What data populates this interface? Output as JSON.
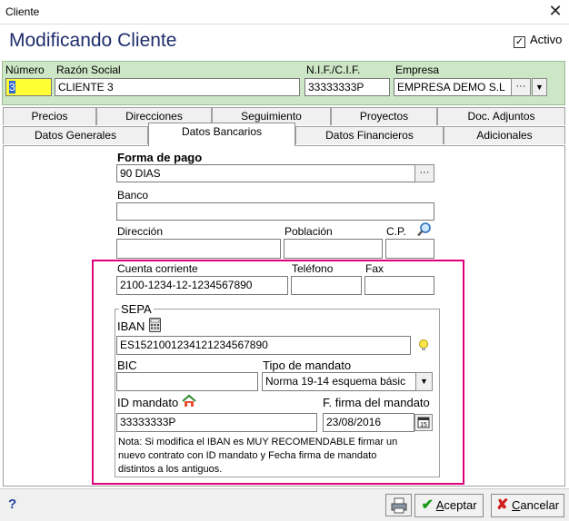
{
  "window": {
    "title": "Cliente",
    "close_glyph": "✕"
  },
  "heading": "Modificando Cliente",
  "activo": {
    "label": "Activo",
    "checked": true
  },
  "header_fields": {
    "numero": {
      "label": "Número",
      "value": "3"
    },
    "razon_social": {
      "label": "Razón Social",
      "value": "CLIENTE 3"
    },
    "nif": {
      "label": "N.I.F./C.I.F.",
      "value": "33333333P"
    },
    "empresa": {
      "label": "Empresa",
      "value": "EMPRESA DEMO S.L"
    }
  },
  "tabs_row1": [
    "Precios",
    "Direcciones",
    "Seguimiento",
    "Proyectos",
    "Doc. Adjuntos"
  ],
  "tabs_row2": [
    "Datos Generales",
    "Datos Bancarios",
    "Datos Financieros",
    "Adicionales"
  ],
  "active_tab": "Datos Bancarios",
  "form": {
    "forma_pago": {
      "label": "Forma de pago",
      "value": "90 DIAS"
    },
    "banco": {
      "label": "Banco",
      "value": ""
    },
    "direccion": {
      "label": "Dirección",
      "value": ""
    },
    "poblacion": {
      "label": "Población",
      "value": ""
    },
    "cp": {
      "label": "C.P.",
      "value": ""
    },
    "cuenta": {
      "label": "Cuenta corriente",
      "value": "2100-1234-12-1234567890"
    },
    "telefono": {
      "label": "Teléfono",
      "value": ""
    },
    "fax": {
      "label": "Fax",
      "value": ""
    }
  },
  "sepa": {
    "legend": "SEPA",
    "iban": {
      "label": "IBAN",
      "value": "ES1521001234121234567890"
    },
    "bic": {
      "label": "BIC",
      "value": ""
    },
    "tipo_mandato": {
      "label": "Tipo de mandato",
      "value": "Norma 19-14 esquema básic"
    },
    "id_mandato": {
      "label": "ID mandato",
      "value": "33333333P"
    },
    "fecha_firma": {
      "label": "F. firma del mandato",
      "value": "23/08/2016"
    },
    "note_lines": [
      "Nota: Si modifica el IBAN es MUY RECOMENDABLE firmar un",
      "nuevo contrato con ID mandato y Fecha firma de mandato",
      "distintos a los antiguos."
    ]
  },
  "bottom": {
    "help": "?",
    "aceptar_prefix": "A",
    "aceptar_rest": "ceptar",
    "cancelar_prefix": "C",
    "cancelar_rest": "ancelar"
  },
  "colors": {
    "accent_pink": "#e0007a",
    "header_green": "#cde6c5",
    "heading_blue": "#1f2d6b",
    "numero_highlight": "#ffff33"
  }
}
